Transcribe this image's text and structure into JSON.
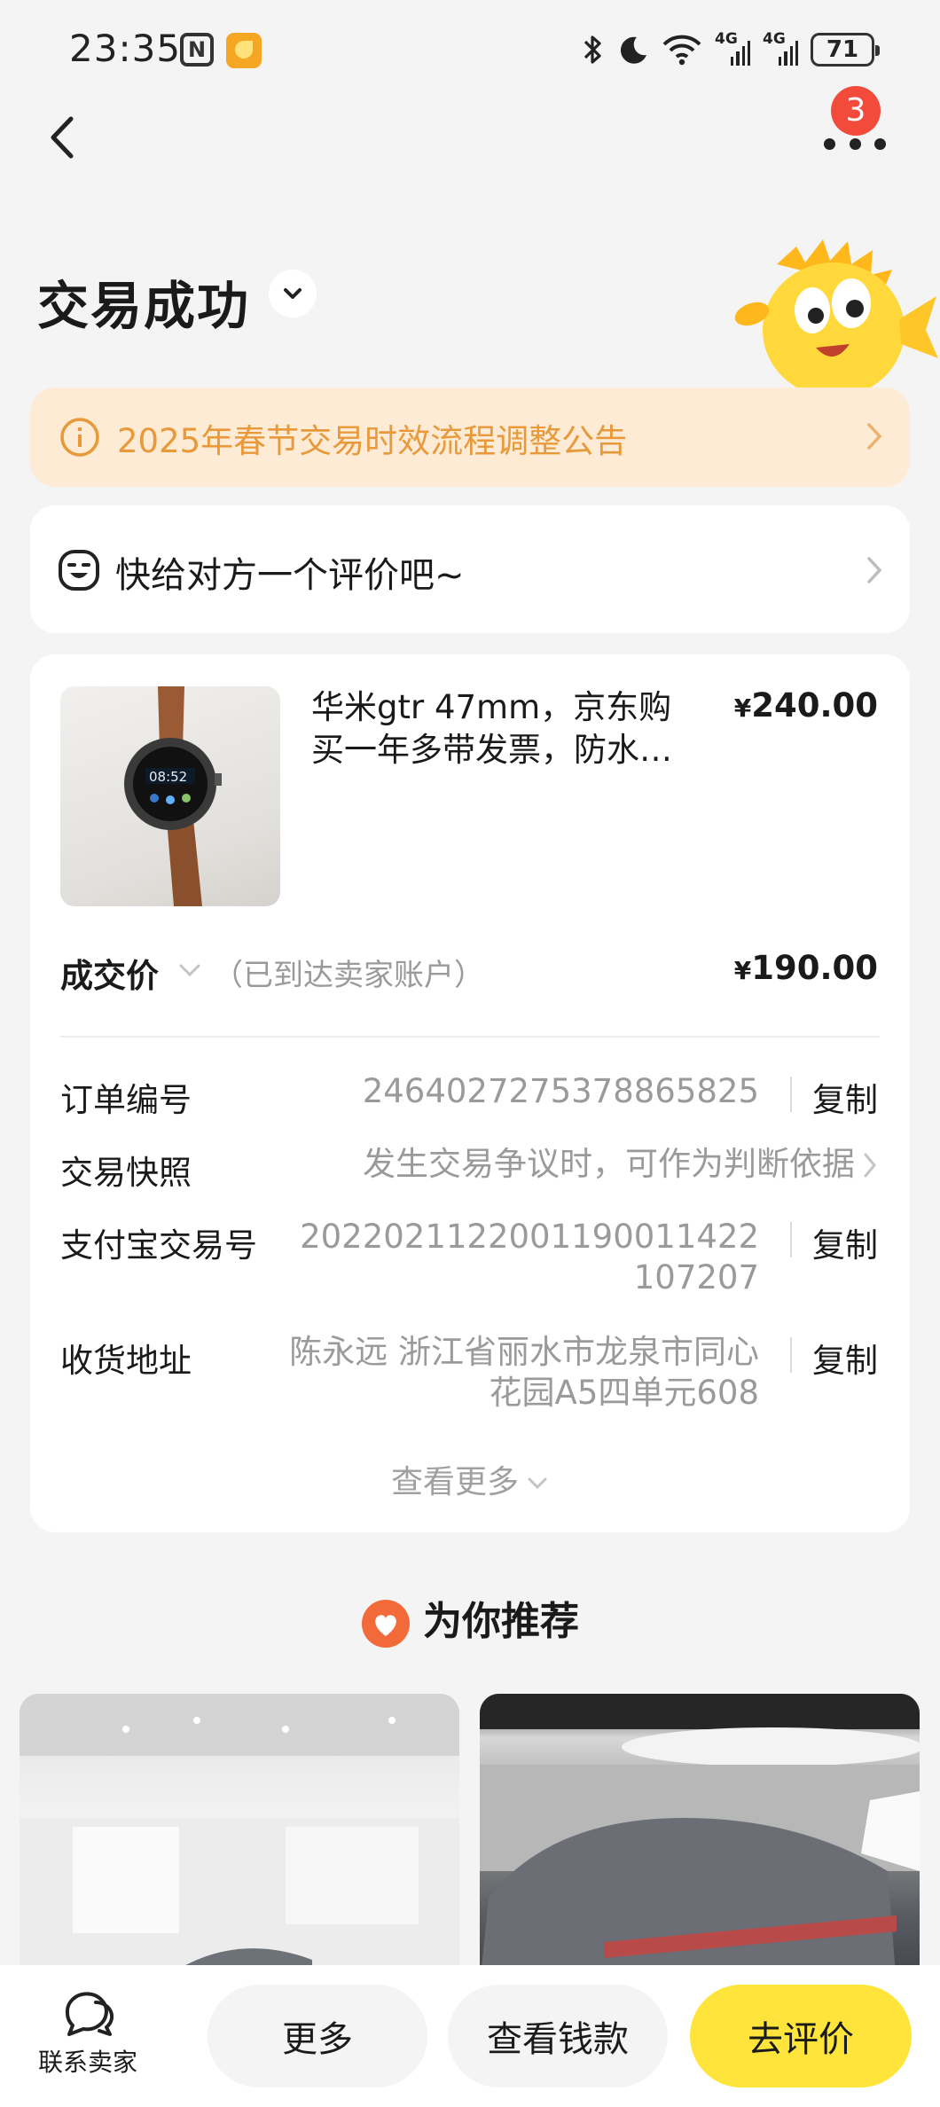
{
  "status_bar": {
    "time": "23:35",
    "nfc": "N",
    "battery": "71",
    "network_1": "4G",
    "network_2": "4G",
    "icons": [
      "nfc-icon",
      "app-icon",
      "bluetooth-icon",
      "moon-icon",
      "wifi-icon",
      "signal-icon",
      "battery-icon"
    ]
  },
  "nav": {
    "back_icon": "back-chevron-icon",
    "more_icon": "more-dots-icon",
    "badge_count": "3"
  },
  "header": {
    "title": "交易成功"
  },
  "notice": {
    "text": "2025年春节交易时效流程调整公告",
    "color": "#e89a3a",
    "background": "#fdebd6"
  },
  "rate_prompt": {
    "text": "快给对方一个评价吧~"
  },
  "order": {
    "product_title": "华米gtr 47mm，京东购买一年多带发票，防水…",
    "product_price_currency": "¥",
    "product_price": "240.00",
    "deal_label": "成交价",
    "deal_sub": "（已到达卖家账户）",
    "deal_price_currency": "¥",
    "deal_price": "190.00",
    "rows": [
      {
        "label": "订单编号",
        "value": "2464027275378865825",
        "action": "复制"
      },
      {
        "label": "交易快照",
        "value": "发生交易争议时，可作为判断依据"
      },
      {
        "label": "支付宝交易号",
        "value_line1": "2022021122001190011422",
        "value_line2": "107207",
        "action": "复制"
      },
      {
        "label": "收货地址",
        "value_line1": "陈永远 浙江省丽水市龙泉市同心",
        "value_line2": "花园A5四单元608",
        "action": "复制"
      }
    ],
    "see_more": "查看更多"
  },
  "recommend": {
    "title": "为你推荐"
  },
  "bottom_bar": {
    "contact_label": "联系卖家",
    "more_label": "更多",
    "money_label": "查看钱款",
    "rate_label": "去评价",
    "accent": "#ffe53b"
  }
}
